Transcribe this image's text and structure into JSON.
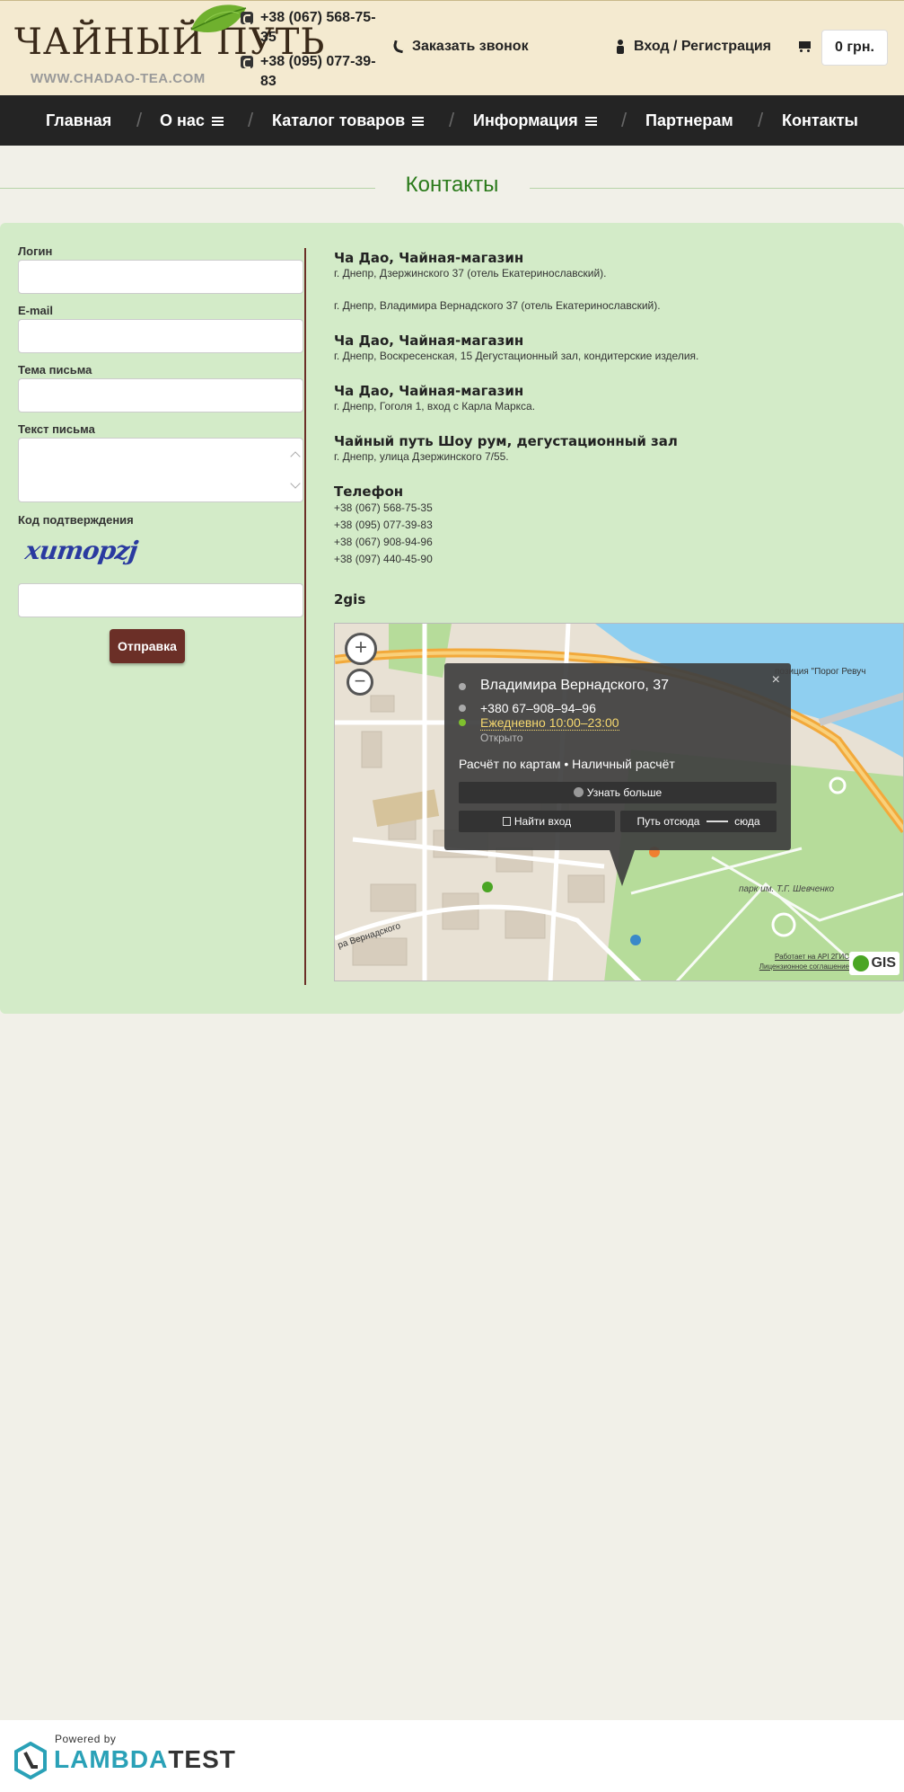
{
  "header": {
    "logo_title": "ЧАЙНЫЙ ПУТЬ",
    "logo_sub": "WWW.CHADAO-TEA.COM",
    "phones": [
      "+38 (067) 568-75-35",
      "+38 (095) 077-39-83"
    ],
    "callback_label": "Заказать звонок",
    "login_label": "Вход / Регистрация",
    "cart_total": "0 грн."
  },
  "nav": {
    "items": [
      "Главная",
      "О нас",
      "Каталог товаров",
      "Информация",
      "Партнерам",
      "Контакты"
    ],
    "separator": "/"
  },
  "page": {
    "title": "Контакты"
  },
  "form": {
    "login_label": "Логин",
    "login_value": "",
    "email_label": "E-mail",
    "email_value": "",
    "subject_label": "Тема письма",
    "subject_value": "",
    "message_label": "Текст письма",
    "message_value": "",
    "code_label": "Код подтверждения",
    "captcha_text": "xumopzj",
    "code_value": "",
    "submit_label": "Отправка"
  },
  "contacts": {
    "shop1_title": "Ча Дао, Чайная-магазин",
    "shop1_line1": "г. Днепр, Дзержинского 37 (отель Екатеринославский).",
    "shop1_line2": "г. Днепр, Владимира Вернадского 37 (отель Екатеринославский).",
    "shop2_title": "Ча Дао, Чайная-магазин",
    "shop2_line": "г. Днепр, Воскресенская, 15 Дегустационный зал, кондитерские изделия.",
    "shop3_title": "Ча Дао, Чайная-магазин",
    "shop3_line": "г. Днепр, Гоголя 1, вход с Карла Маркса.",
    "shop4_title": "Чайный путь Шоу рум, дегустационный зал",
    "shop4_line": "г. Днепр, улица Дзержинского 7/55.",
    "phone_title": "Телефон",
    "phones": [
      "+38 (067) 568-75-35",
      "+38 (095) 077-39-83",
      "+38 (067) 908-94-96",
      "+38 (097) 440-45-90"
    ],
    "map_title": "2gis"
  },
  "map": {
    "zoom_in": "+",
    "zoom_out": "−",
    "popup_title": "Владимира Вернадского, 37",
    "popup_phone": "+380 67–908–94–96",
    "popup_hours": "Ежедневно 10:00–23:00",
    "popup_status": "Открыто",
    "popup_payment": "Расчёт по картам • Наличный расчёт",
    "popup_more": "Узнать больше",
    "popup_enter": "Найти вход",
    "popup_route_from": "Путь отсюда",
    "popup_route_to": "сюда",
    "popup_close": "×",
    "label_park": "парк им. Т.Г. Шевченко",
    "label_street": "ра Вернадского",
    "label_poi": "позиция \"Порог Ревуч",
    "credit_line1": "Работает на API 2ГИС",
    "credit_line2": "Лицензионное соглашение",
    "logo_text": "GIS",
    "colors": {
      "water": "#8fcff0",
      "park": "#b6dc9a",
      "road": "#f2a93b",
      "urban": "#e8e1d4"
    }
  },
  "footer": {
    "powered": "Powered by",
    "brand_a": "LAMBDA",
    "brand_b": "TEST"
  }
}
